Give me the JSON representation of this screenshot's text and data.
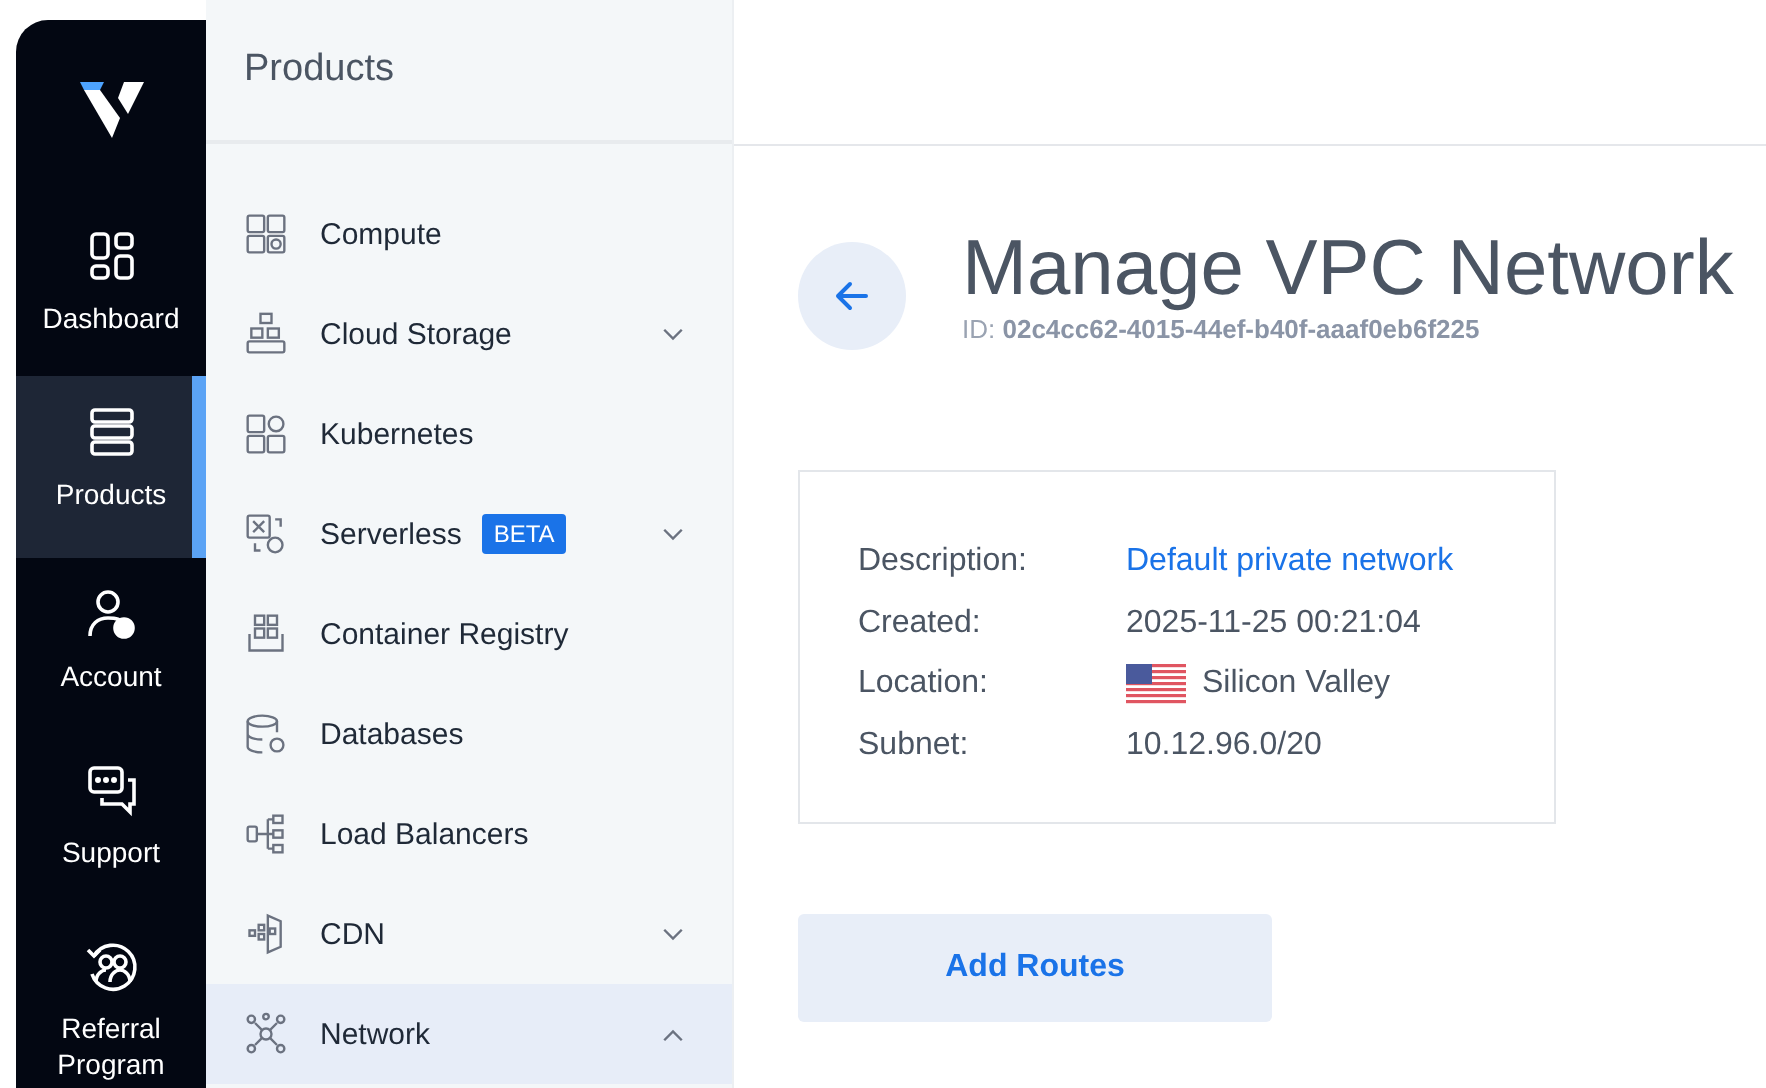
{
  "rail": {
    "items": [
      {
        "label": "Dashboard",
        "selected": false
      },
      {
        "label": "Products",
        "selected": true
      },
      {
        "label": "Account",
        "selected": false
      },
      {
        "label": "Support",
        "selected": false
      },
      {
        "label": "Referral Program",
        "selected": false
      }
    ]
  },
  "products": {
    "title": "Products",
    "items": [
      {
        "label": "Compute",
        "selected": false
      },
      {
        "label": "Cloud Storage",
        "selected": false,
        "expanded": false
      },
      {
        "label": "Kubernetes",
        "selected": false
      },
      {
        "label": "Serverless",
        "selected": false,
        "expanded": false,
        "badge": "BETA"
      },
      {
        "label": "Container Registry",
        "selected": false
      },
      {
        "label": "Databases",
        "selected": false
      },
      {
        "label": "Load Balancers",
        "selected": false
      },
      {
        "label": "CDN",
        "selected": false,
        "expanded": false
      },
      {
        "label": "Network",
        "selected": true,
        "expanded": true
      }
    ]
  },
  "page": {
    "title": "Manage VPC Network",
    "id": "ID: **02c4cc62-4015-44ef-b40f-aaaf0eb6f225**"
  },
  "details": [
    {
      "label": "Description:",
      "value": "Default private network",
      "kind": "link"
    },
    {
      "label": "Created:",
      "value": "2025-11-25 00:21:04",
      "kind": "text"
    },
    {
      "label": "Location:",
      "value": "Silicon Valley",
      "kind": "flag"
    },
    {
      "label": "Subnet:",
      "value": "10.12.96.0/20",
      "kind": "text"
    }
  ],
  "buttons": [
    "Add Routes"
  ]
}
